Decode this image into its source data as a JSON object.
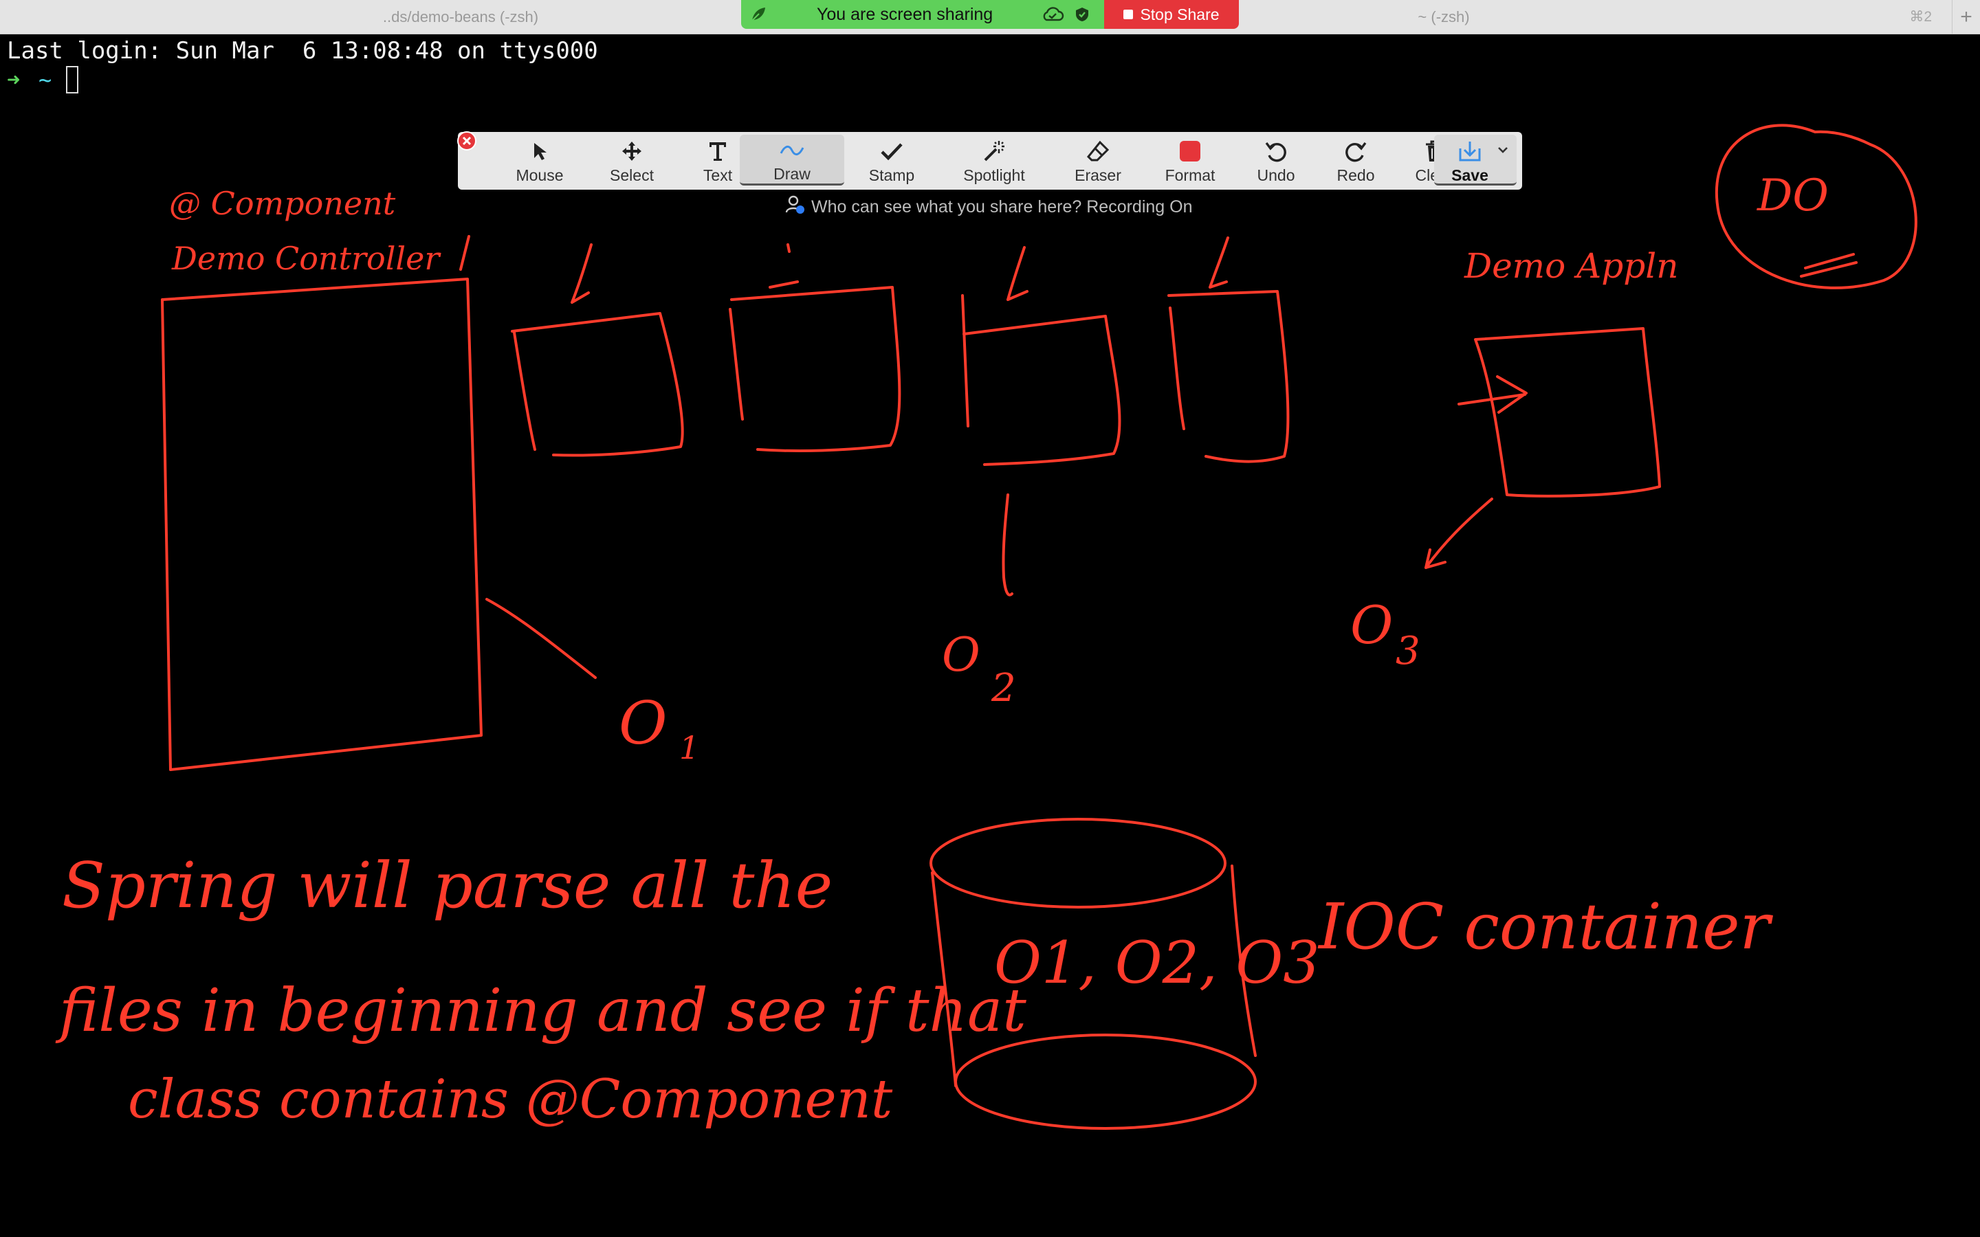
{
  "tabs": [
    {
      "label": "..ds/demo-beans (-zsh)"
    },
    {
      "label": "~ (-zsh)",
      "shortcut": "⌘2"
    }
  ],
  "tab_add": "+",
  "share_banner": {
    "status": "You are screen sharing",
    "stop_label": "Stop Share",
    "green": "#5fd05a",
    "red": "#e5353a"
  },
  "terminal": {
    "last_login": "Last login: Sun Mar  6 13:08:48 on ttys000",
    "prompt_arrow": "➜",
    "prompt_dir": "~"
  },
  "annotate_toolbar": {
    "tools": [
      {
        "label": "Mouse",
        "icon": "cursor-arrow-icon"
      },
      {
        "label": "Select",
        "icon": "move-arrows-icon"
      },
      {
        "label": "Text",
        "icon": "text-t-icon"
      },
      {
        "label": "Draw",
        "icon": "squiggle-icon",
        "active": true
      },
      {
        "label": "Stamp",
        "icon": "checkmark-icon"
      },
      {
        "label": "Spotlight",
        "icon": "magic-wand-icon"
      },
      {
        "label": "Eraser",
        "icon": "eraser-icon"
      },
      {
        "label": "Format",
        "icon": "color-square-icon"
      },
      {
        "label": "Undo",
        "icon": "undo-icon"
      },
      {
        "label": "Redo",
        "icon": "redo-icon"
      },
      {
        "label": "Clear",
        "icon": "trash-icon"
      },
      {
        "label": "Save",
        "icon": "save-download-icon"
      }
    ],
    "recording_text": "Who can see what you share here? Recording On"
  },
  "drawing": {
    "ink_color": "#ff3b2b",
    "labels": {
      "component_note": "@ Component",
      "controller_note": "Demo Controller",
      "app_note": "Demo Appln",
      "o1": "O",
      "o1_sub": "1",
      "o2": "O",
      "o2_sub": "2",
      "o3": "O",
      "o3_sub": "3",
      "ioc": "IOC container",
      "container_contents": "O1, O2, O3",
      "corner_note": "DO",
      "sentence_line1": "Spring will parse all the",
      "sentence_line2": "files in beginning and see if that",
      "sentence_line3": "class contains @Component"
    }
  }
}
